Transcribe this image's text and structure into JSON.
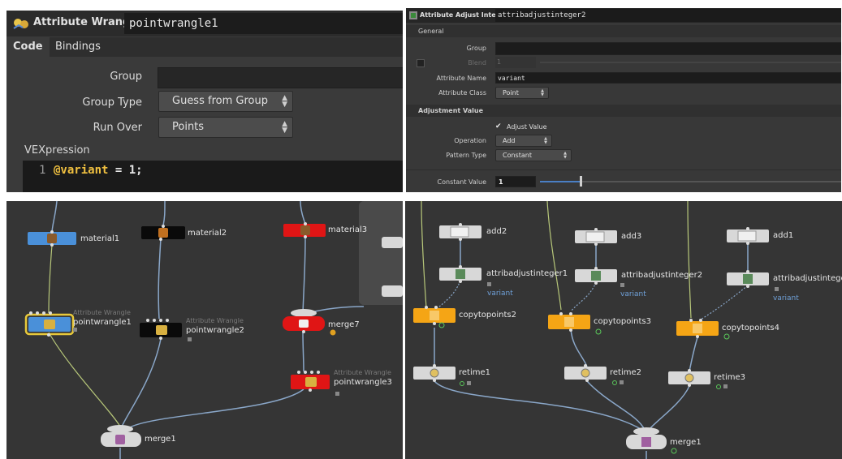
{
  "wrangle_panel": {
    "node_type": "Attribute Wrangle",
    "node_name": "pointwrangle1",
    "tabs": [
      "Code",
      "Bindings"
    ],
    "group_label": "Group",
    "group_value": "",
    "group_type_label": "Group Type",
    "group_type_value": "Guess from Group",
    "run_over_label": "Run Over",
    "run_over_value": "Points",
    "vex_label": "VEXpression",
    "code_line_number": "1",
    "code_var": "@variant",
    "code_rest": " = 1;"
  },
  "adjust_panel": {
    "node_type": "Attribute Adjust Integer",
    "node_name": "attribadjustinteger2",
    "section_general": "General",
    "group_label": "Group",
    "blend_label": "Blend",
    "blend_value": "1",
    "attribute_name_label": "Attribute Name",
    "attribute_name_value": "variant",
    "attribute_class_label": "Attribute Class",
    "attribute_class_value": "Point",
    "section_adjust": "Adjustment Value",
    "adjust_value_checkbox": "Adjust Value",
    "operation_label": "Operation",
    "operation_value": "Add",
    "pattern_type_label": "Pattern Type",
    "pattern_type_value": "Constant",
    "constant_value_label": "Constant Value",
    "constant_value": "1"
  },
  "network_left": {
    "nodes": {
      "material1": "material1",
      "material2": "material2",
      "material3": "material3",
      "pointwrangle1": "pointwrangle1",
      "pointwrangle2": "pointwrangle2",
      "pointwrangle3": "pointwrangle3",
      "merge7": "merge7",
      "merge1": "merge1"
    },
    "type_label": "Attribute Wrangle"
  },
  "network_right": {
    "nodes": {
      "add2": "add2",
      "add3": "add3",
      "add1": "add1",
      "attribadjustinteger1": "attribadjustinteger1",
      "attribadjustinteger2": "attribadjustinteger2",
      "attribadjustinteger3": "attribadjustintege",
      "copytopoints2": "copytopoints2",
      "copytopoints3": "copytopoints3",
      "copytopoints4": "copytopoints4",
      "retime1": "retime1",
      "retime2": "retime2",
      "retime3": "retime3",
      "merge1": "merge1"
    },
    "variant_label": "variant"
  },
  "colors": {
    "material1": "#4a90d9",
    "material2": "#0a0a0a",
    "material3": "#e01515",
    "copytopoints": "#f5a515",
    "wrangle_selected": "#e8c93a",
    "wire_blue": "#8aa7c9",
    "wire_green": "#b8c87a"
  }
}
